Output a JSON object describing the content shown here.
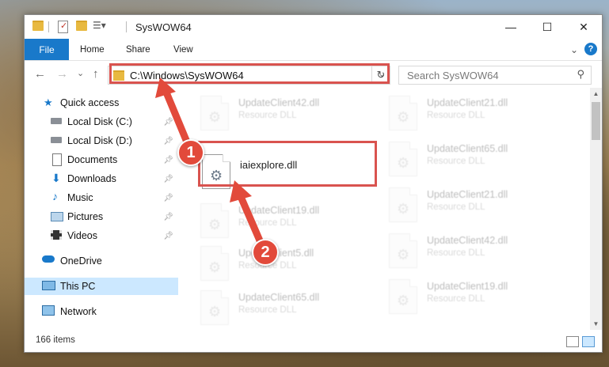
{
  "window": {
    "title": "SysWOW64",
    "controls": {
      "minimize": "—",
      "maximize": "☐",
      "close": "✕"
    }
  },
  "ribbon": {
    "file_tab": "File",
    "tabs": [
      "Home",
      "Share",
      "View"
    ],
    "expand_icon": "chevron-down-icon",
    "help": "?"
  },
  "nav": {
    "back": "←",
    "forward": "→",
    "recent": "⌄",
    "up": "↑",
    "address_path": "C:\\Windows\\SysWOW64",
    "address_dropdown": "⌄",
    "refresh": "↻",
    "search_placeholder": "Search SysWOW64",
    "search_icon": "search-icon"
  },
  "sidebar": {
    "items": [
      {
        "label": "Quick access",
        "icon": "star-icon",
        "pinned": false
      },
      {
        "label": "Local Disk (C:)",
        "icon": "drive-icon",
        "pinned": true
      },
      {
        "label": "Local Disk (D:)",
        "icon": "drive-icon",
        "pinned": true
      },
      {
        "label": "Documents",
        "icon": "documents-icon",
        "pinned": true
      },
      {
        "label": "Downloads",
        "icon": "downloads-icon",
        "pinned": true
      },
      {
        "label": "Music",
        "icon": "music-icon",
        "pinned": true
      },
      {
        "label": "Pictures",
        "icon": "pictures-icon",
        "pinned": true
      },
      {
        "label": "Videos",
        "icon": "videos-icon",
        "pinned": true
      },
      {
        "label": "OneDrive",
        "icon": "cloud-icon",
        "pinned": false
      },
      {
        "label": "This PC",
        "icon": "computer-icon",
        "pinned": false,
        "selected": true
      },
      {
        "label": "Network",
        "icon": "network-icon",
        "pinned": false
      }
    ]
  },
  "files": {
    "left": [
      {
        "name": "UpdateClient42.dll",
        "type": "Resource DLL"
      },
      {
        "name": "iaiexplore.dll",
        "type": ""
      },
      {
        "name": "UpdateClient19.dll",
        "type": "Resource DLL"
      },
      {
        "name": "UpdateClient5.dll",
        "type": "Resource DLL"
      },
      {
        "name": "UpdateClient65.dll",
        "type": "Resource DLL"
      }
    ],
    "right": [
      {
        "name": "UpdateClient21.dll",
        "type": "Resource DLL"
      },
      {
        "name": "UpdateClient65.dll",
        "type": "Resource DLL"
      },
      {
        "name": "UpdateClient21.dll",
        "type": "Resource DLL"
      },
      {
        "name": "UpdateClient42.dll",
        "type": "Resource DLL"
      },
      {
        "name": "UpdateClient19.dll",
        "type": "Resource DLL"
      }
    ]
  },
  "status": {
    "item_count": "166 items"
  },
  "annotations": {
    "step1": "1",
    "step2": "2",
    "color": "#e24a3b"
  }
}
